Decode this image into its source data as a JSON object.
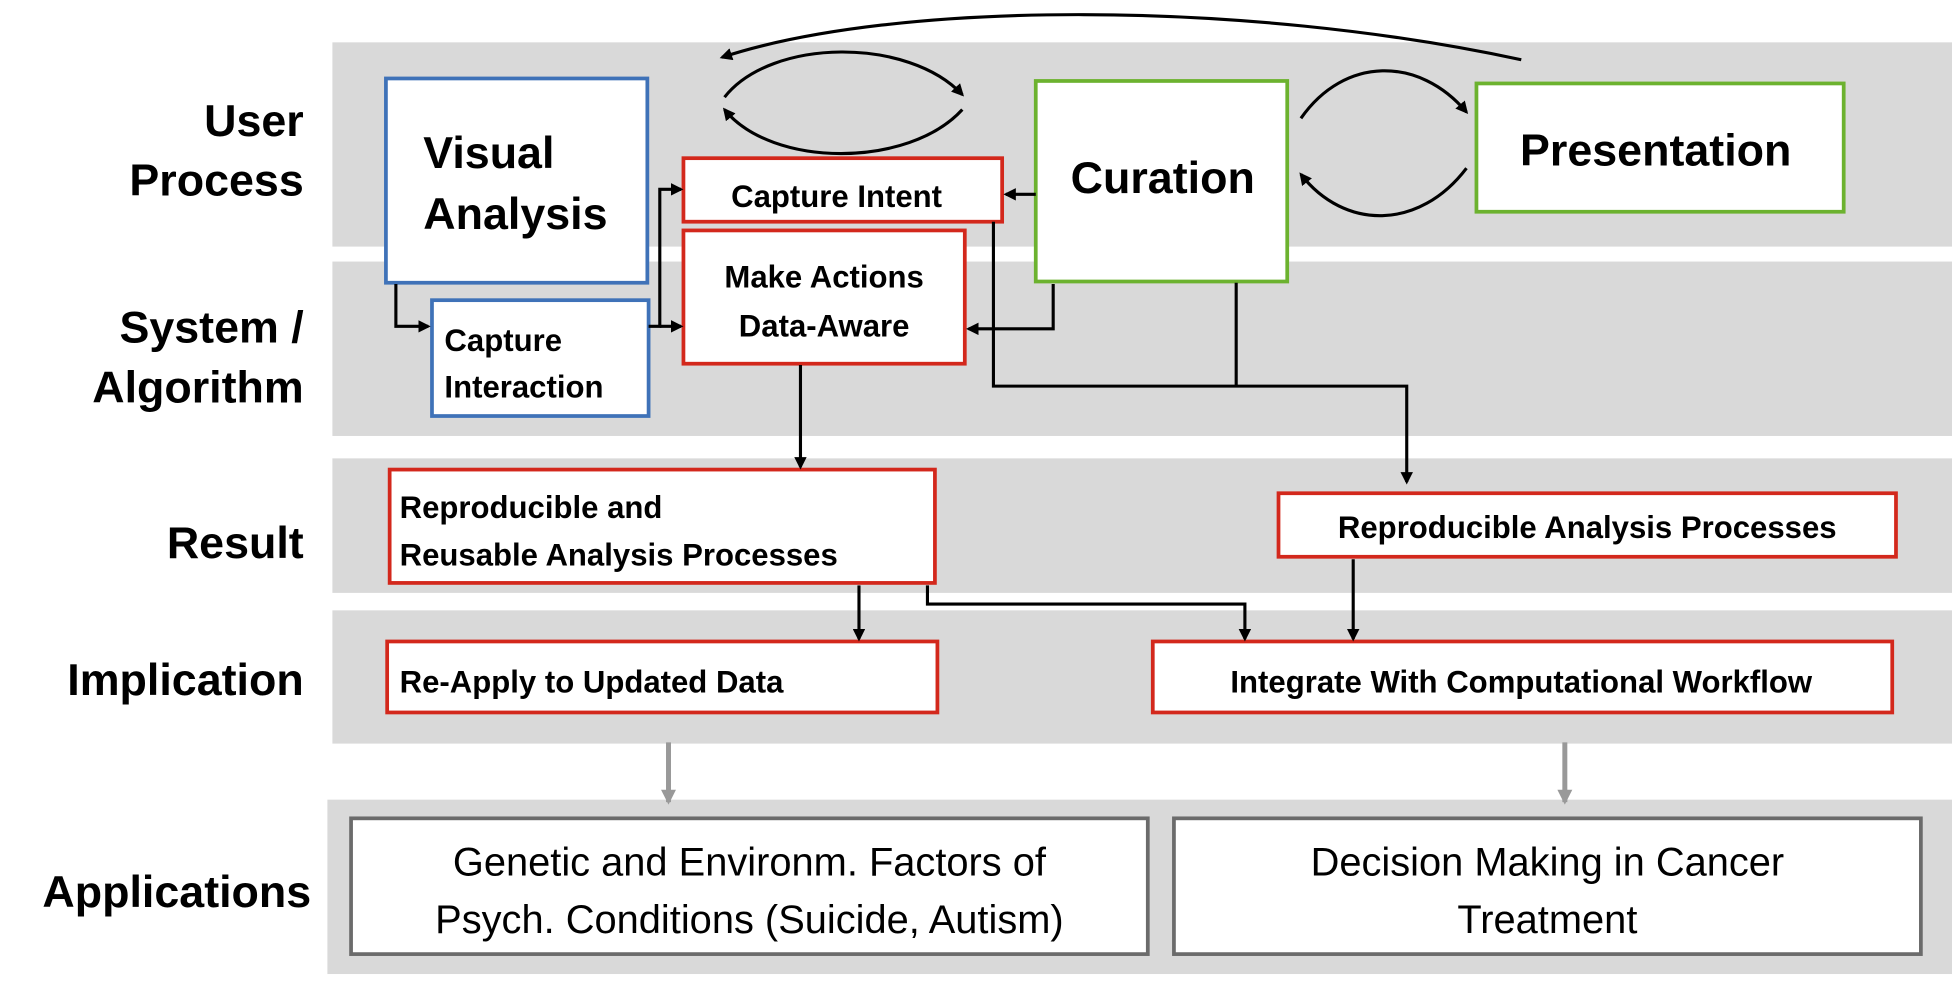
{
  "colors": {
    "band": "#d9d9d9",
    "user_box": "#3f72b8",
    "curation_box": "#6cb22f",
    "system_box": "#d3281c",
    "application_box": "#6b6b6b",
    "link_arrow": "#999999"
  },
  "rows": {
    "user_process": [
      "User",
      "Process"
    ],
    "system_algorithm": [
      "System /",
      "Algorithm"
    ],
    "result": "Result",
    "implication": "Implication",
    "applications": "Applications"
  },
  "boxes": {
    "visual_analysis": [
      "Visual",
      "Analysis"
    ],
    "capture_intent": "Capture Intent",
    "make_actions": [
      "Make Actions",
      "Data-Aware"
    ],
    "capture_interaction": [
      "Capture",
      "Interaction"
    ],
    "curation": "Curation",
    "presentation": "Presentation",
    "reproducible_reusable": [
      "Reproducible and",
      "Reusable Analysis Processes"
    ],
    "reproducible_analysis": "Reproducible Analysis Processes",
    "reapply": "Re-Apply to Updated Data",
    "integrate": "Integrate With Computational Workflow",
    "app_genetic": [
      "Genetic and Environm. Factors of",
      "Psych. Conditions (Suicide, Autism)"
    ],
    "app_cancer": [
      "Decision Making in Cancer",
      "Treatment"
    ]
  }
}
